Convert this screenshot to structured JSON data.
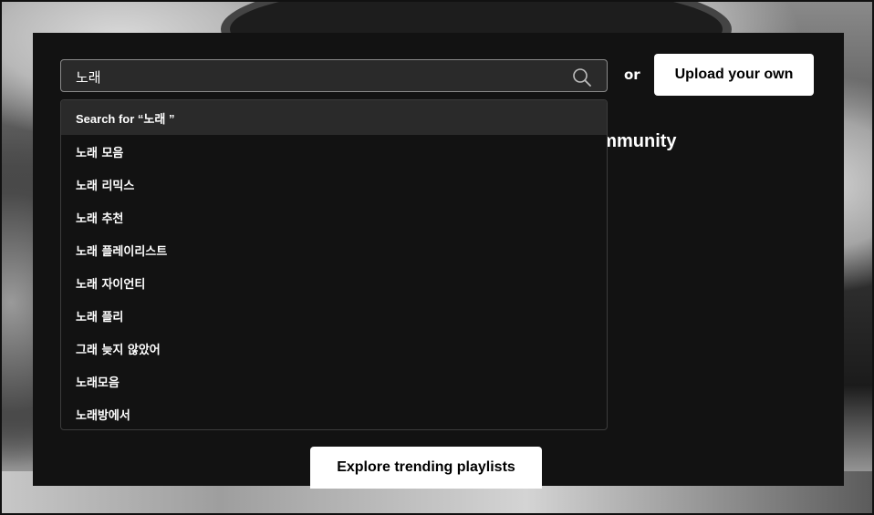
{
  "search": {
    "value": "노래",
    "icon": "search-icon"
  },
  "or_label": "or",
  "upload_button": "Upload your own",
  "background_heading_fragment": "ommunity",
  "dropdown": {
    "header": "Search for “노래 ”",
    "suggestions": [
      "노래 모음",
      "노래 리믹스",
      "노래 추천",
      "노래 플레이리스트",
      "노래 자이언티",
      "노래 플리",
      "그래 늦지 않았어",
      "노래모음",
      "노래방에서"
    ]
  },
  "explore_button": "Explore trending playlists",
  "colors": {
    "panel": "#121212",
    "input_bg": "#2a2a2a",
    "button_bg": "#ffffff",
    "text": "#ffffff"
  }
}
